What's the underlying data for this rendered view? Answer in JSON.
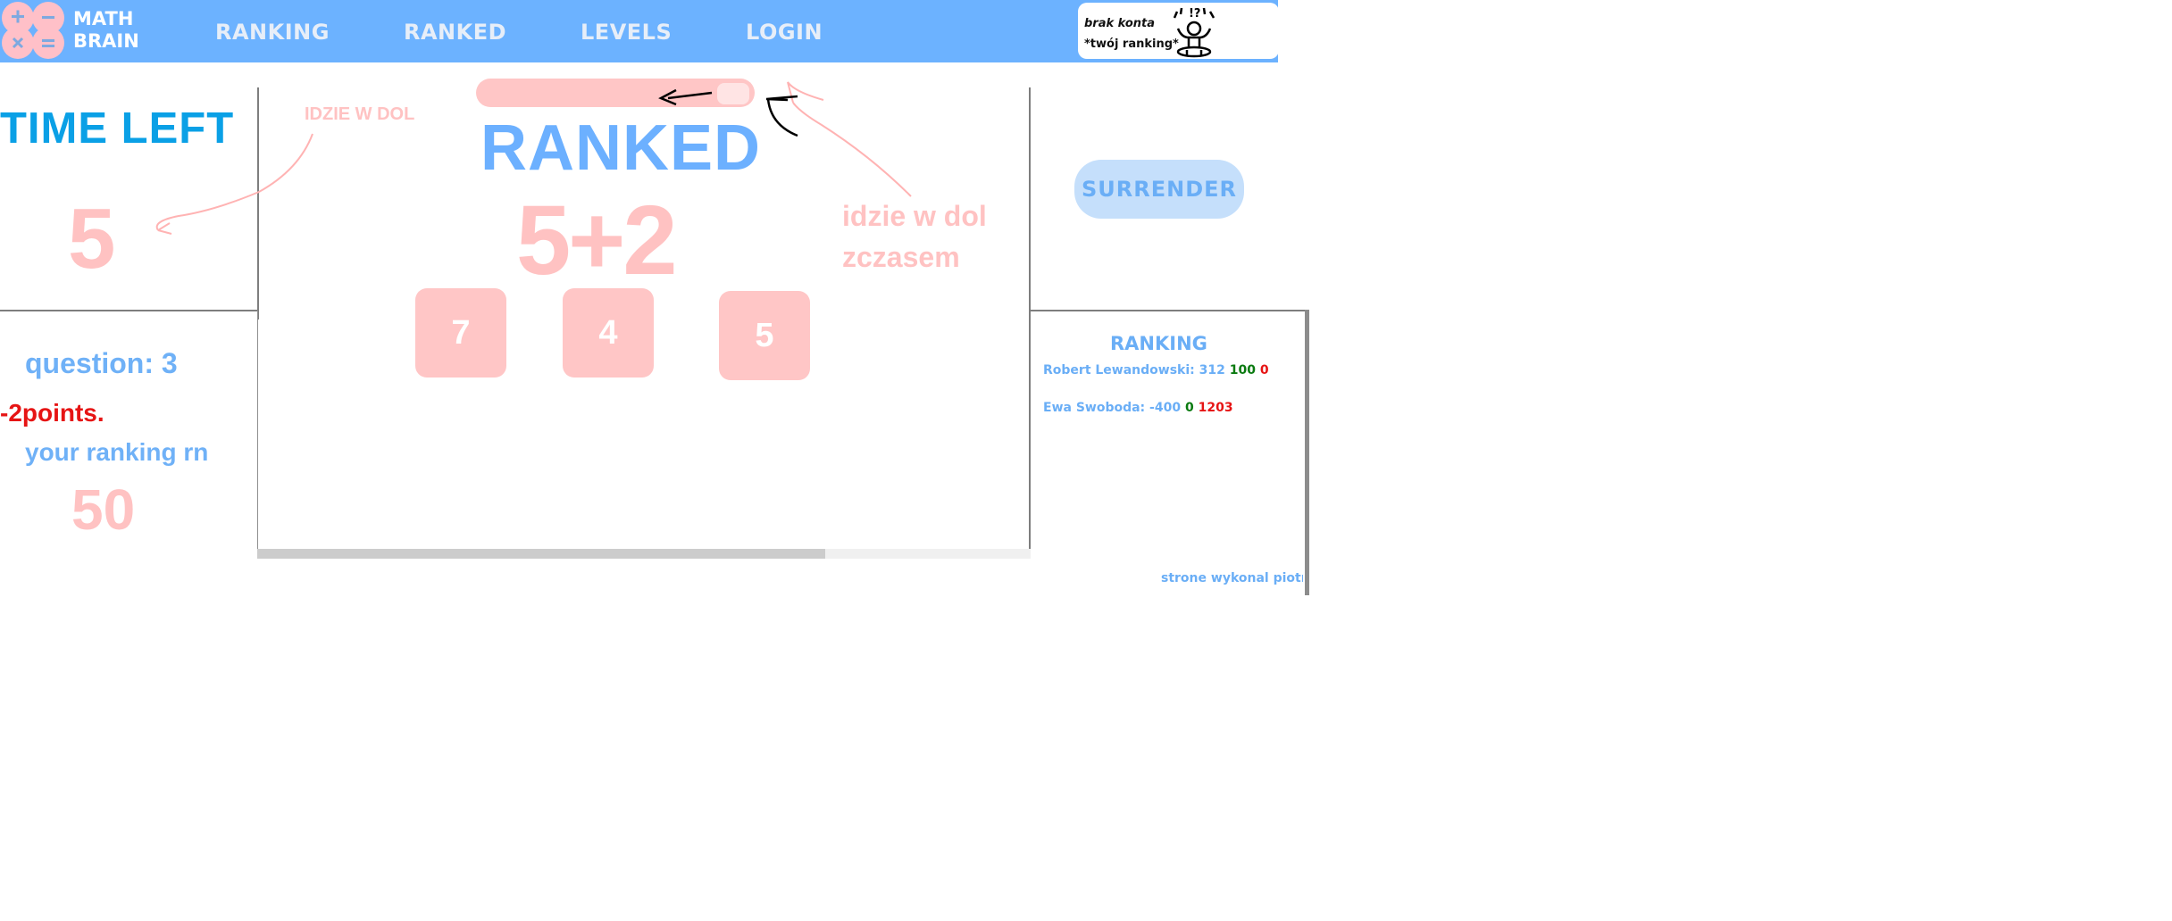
{
  "header": {
    "logo_line1": "MATH",
    "logo_line2": "BRAIN",
    "nav": [
      "RANKING",
      "RANKED",
      "LEVELS",
      "LOGIN"
    ],
    "account_line1": "brak konta",
    "account_line2": "*twój ranking*"
  },
  "left": {
    "time_left_label": "TIME LEFT",
    "timer_value": "5",
    "question_label": "question: 3",
    "points_text": "-2points.",
    "ranking_label": "your ranking rn",
    "ranking_value": "50"
  },
  "game": {
    "title": "RANKED",
    "equation": "5+2",
    "answers": [
      "7",
      "4",
      "5"
    ],
    "note_small": "IDZIE W DOL",
    "note_big_line1": "idzie w dol",
    "note_big_line2": "zczasem"
  },
  "right": {
    "surrender_label": "SURRENDER",
    "ranking_title": "RANKING",
    "rows": [
      {
        "name": "Robert Lewandowski:",
        "score": "312",
        "wins": "100",
        "losses": "0"
      },
      {
        "name": "Ewa Swoboda:",
        "score": "-400",
        "wins": "0",
        "losses": "1203"
      }
    ],
    "footer": "strone wykonal piotrek"
  },
  "colors": {
    "header_bg": "#6cb2ff",
    "accent_blue": "#6cb0ff",
    "pink": "#ffc2c2",
    "red": "#e61414",
    "green": "#0a7a10",
    "time_blue": "#0aa0e6"
  }
}
